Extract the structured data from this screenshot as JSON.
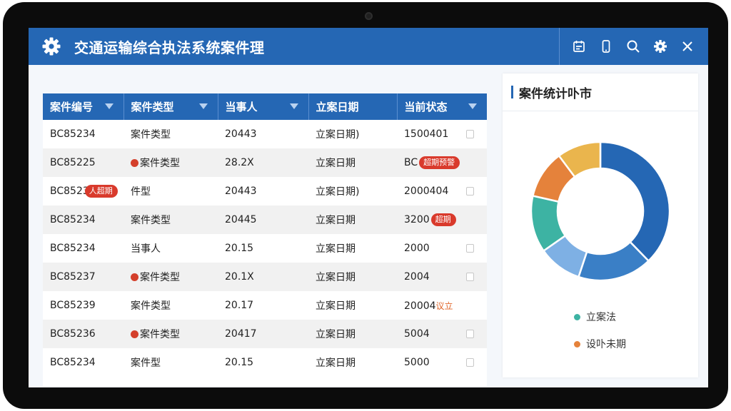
{
  "header": {
    "title": "交通运输综合执法系统案件理",
    "tools": [
      "calendar-icon",
      "phone-icon",
      "search-icon",
      "gear-icon",
      "close-icon"
    ]
  },
  "table": {
    "columns": [
      "案件编号",
      "案件类型",
      "当事人",
      "立案日期",
      "当前状态"
    ],
    "rows": [
      {
        "id": "BC85234",
        "type": "案件类型",
        "party": "20443",
        "date": "立案日期)",
        "status": "1500401",
        "type_warn": false,
        "id_badge": "",
        "status_badge": "",
        "status_note": ""
      },
      {
        "id": "BC85225",
        "type": "案件类型",
        "party": "28.2X",
        "date": "立案日期",
        "status": "BC",
        "type_warn": true,
        "id_badge": "",
        "status_badge": "超期预警",
        "status_note": ""
      },
      {
        "id": "BC8523",
        "type": "件型",
        "party": "20443",
        "date": "立案日期)",
        "status": "2000404",
        "type_warn": false,
        "id_badge": "人超期",
        "status_badge": "",
        "status_note": ""
      },
      {
        "id": "BC85234",
        "type": "案件类型",
        "party": "20445",
        "date": "立案日期",
        "status": "3200",
        "type_warn": false,
        "id_badge": "",
        "status_badge": "超期",
        "status_note": ""
      },
      {
        "id": "BC85234",
        "type": "当事人",
        "party": "20.15",
        "date": "立案日期",
        "status": "2000",
        "type_warn": false,
        "id_badge": "",
        "status_badge": "",
        "status_note": ""
      },
      {
        "id": "BC85237",
        "type": "案件类型",
        "party": "20.1X",
        "date": "立案日期",
        "status": "2004",
        "type_warn": true,
        "id_badge": "",
        "status_badge": "",
        "status_note": ""
      },
      {
        "id": "BC85239",
        "type": "案件类型",
        "party": "20.17",
        "date": "立案日期",
        "status": "20004",
        "type_warn": false,
        "id_badge": "",
        "status_badge": "",
        "status_note": "议立"
      },
      {
        "id": "BC85236",
        "type": "案件类型",
        "party": "20417",
        "date": "立案日期",
        "status": "5004",
        "type_warn": true,
        "id_badge": "",
        "status_badge": "",
        "status_note": ""
      },
      {
        "id": "BC85234",
        "type": "案件型",
        "party": "20.15",
        "date": "立案日期",
        "status": "5000",
        "type_warn": false,
        "id_badge": "",
        "status_badge": "",
        "status_note": ""
      }
    ]
  },
  "chart": {
    "title": "案件统计卟市",
    "legend": [
      {
        "label": "立案法",
        "color": "#3db3a3"
      },
      {
        "label": "设卟未期",
        "color": "#e5823b"
      }
    ]
  },
  "chart_data": {
    "type": "pie",
    "categories": [
      "蓝色",
      "中蓝",
      "浅蓝",
      "青绿",
      "橙色",
      "黄色"
    ],
    "values": [
      37,
      17,
      10,
      13,
      11,
      10
    ],
    "colors": [
      "#2567b4",
      "#3a7fc6",
      "#7eb0e4",
      "#3db3a3",
      "#e5823b",
      "#eab54d"
    ],
    "title": "案件统计卟市",
    "legend": "bottom"
  }
}
